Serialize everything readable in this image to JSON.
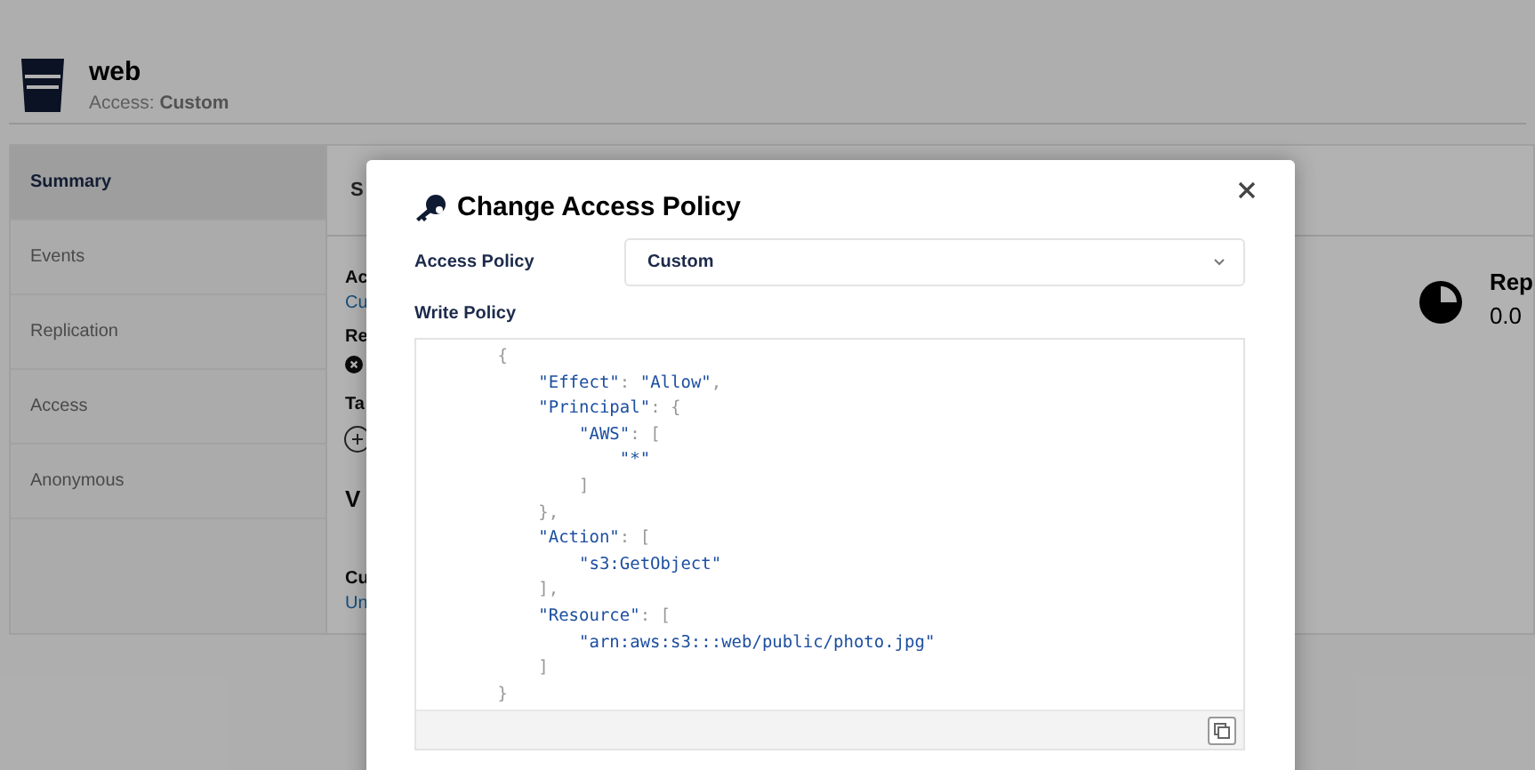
{
  "bucket": {
    "name": "web",
    "access_label": "Access:",
    "access_value": "Custom"
  },
  "sidebar": {
    "items": [
      {
        "label": "Summary",
        "selected": true
      },
      {
        "label": "Events",
        "selected": false
      },
      {
        "label": "Replication",
        "selected": false
      },
      {
        "label": "Access",
        "selected": false
      },
      {
        "label": "Anonymous",
        "selected": false
      }
    ]
  },
  "summary": {
    "tab": "S",
    "access_heading": "Ac",
    "access_value": "Cu",
    "replication_heading": "Re",
    "tags_heading": "Ta",
    "section_heading": "V",
    "custom_heading": "Cu",
    "custom_value": "Un",
    "usage_heading": "Rep",
    "usage_value": "0.0"
  },
  "dialog": {
    "title": "Change Access Policy",
    "access_policy_label": "Access Policy",
    "access_policy_value": "Custom",
    "write_policy_label": "Write Policy",
    "code_lines": [
      "        {",
      "            \"Effect\": \"Allow\",",
      "            \"Principal\": {",
      "                \"AWS\": [",
      "                    \"*\"",
      "                ]",
      "            },",
      "            \"Action\": [",
      "                \"s3:GetObject\"",
      "            ],",
      "            \"Resource\": [",
      "                \"arn:aws:s3:::web/public/photo.jpg\"",
      "            ]",
      "        }"
    ]
  }
}
